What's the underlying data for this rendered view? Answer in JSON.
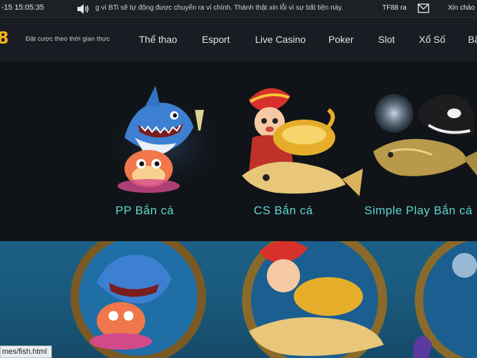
{
  "topbar": {
    "datetime": "-15 15:05:35",
    "marquee": "g ví BTi sẽ tự động được chuyển ra ví chính. Thành thật xin lỗi vì sự bất tiện này.",
    "tf_message": "TF88 ra",
    "greeting": "Xin chào"
  },
  "header": {
    "logo": "8",
    "tagline": "Đặt cược theo thời gian thực",
    "nav": [
      "Thể thao",
      "Esport",
      "Live Casino",
      "Poker",
      "Slot",
      "Xổ Số",
      "Bắ"
    ]
  },
  "games": [
    {
      "name": "PP Bắn cá",
      "icon": "shark-pufferfish-icon"
    },
    {
      "name": "CS Bắn cá",
      "icon": "fortune-god-goldfish-icon"
    },
    {
      "name": "Simple Play Bắn cá",
      "icon": "orca-goldfish-icon"
    }
  ],
  "status_bar": {
    "url": "mes/fish.html"
  },
  "colors": {
    "accent": "#5fd6d0",
    "logo": "#f6b21c",
    "banner": "#1a5b7f"
  }
}
